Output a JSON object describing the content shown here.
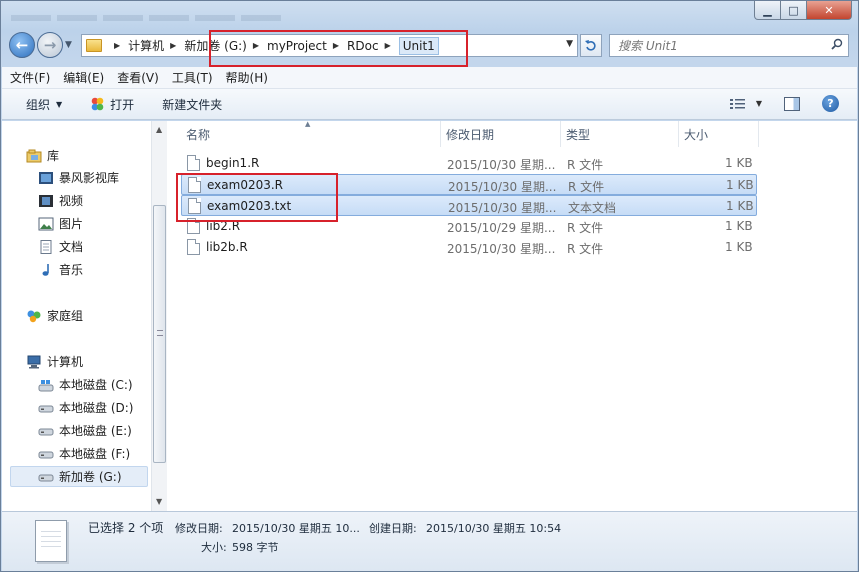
{
  "window": {
    "controls": {
      "minimize": "▁",
      "maximize": "□",
      "close": "✕"
    }
  },
  "address": {
    "crumbs": [
      "计算机",
      "新加卷 (G:)",
      "myProject",
      "RDoc",
      "Unit1"
    ]
  },
  "search": {
    "placeholder": "搜索 Unit1"
  },
  "menu": [
    "文件(F)",
    "编辑(E)",
    "查看(V)",
    "工具(T)",
    "帮助(H)"
  ],
  "toolbar": {
    "organize": "组织",
    "open": "打开",
    "new_folder": "新建文件夹"
  },
  "navpane": {
    "library": "库",
    "library_items": [
      "暴风影视库",
      "视频",
      "图片",
      "文档",
      "音乐"
    ],
    "homegroup": "家庭组",
    "computer": "计算机",
    "drives": [
      "本地磁盘 (C:)",
      "本地磁盘 (D:)",
      "本地磁盘 (E:)",
      "本地磁盘 (F:)",
      "新加卷 (G:)"
    ]
  },
  "columns": {
    "name": "名称",
    "date": "修改日期",
    "type": "类型",
    "size": "大小"
  },
  "files": [
    {
      "name": "begin1.R",
      "date": "2015/10/30 星期...",
      "type": "R 文件",
      "size": "1 KB",
      "selected": false
    },
    {
      "name": "exam0203.R",
      "date": "2015/10/30 星期...",
      "type": "R 文件",
      "size": "1 KB",
      "selected": true
    },
    {
      "name": "exam0203.txt",
      "date": "2015/10/30 星期...",
      "type": "文本文档",
      "size": "1 KB",
      "selected": true
    },
    {
      "name": "lib2.R",
      "date": "2015/10/29 星期...",
      "type": "R 文件",
      "size": "1 KB",
      "selected": false
    },
    {
      "name": "lib2b.R",
      "date": "2015/10/30 星期...",
      "type": "R 文件",
      "size": "1 KB",
      "selected": false
    }
  ],
  "details": {
    "selected": "已选择 2 个项",
    "modified_label": "修改日期:",
    "modified_value": "2015/10/30 星期五 10...",
    "created_label": "创建日期:",
    "created_value": "2015/10/30 星期五 10:54",
    "size_label": "大小:",
    "size_value": "598 字节"
  },
  "colors": {
    "highlight": "#d7212b",
    "selection": "#c6dcf6"
  }
}
